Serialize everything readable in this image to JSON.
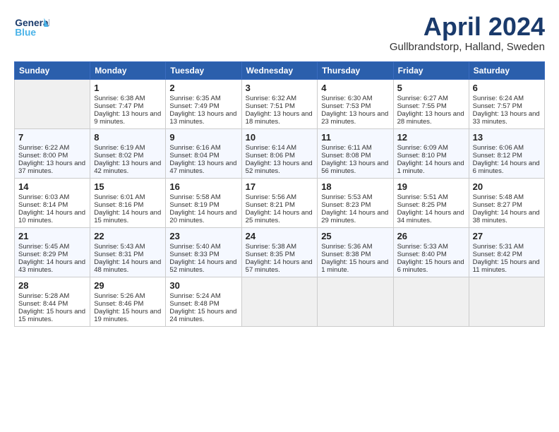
{
  "header": {
    "logo": {
      "line1": "General",
      "line2": "Blue"
    },
    "title": "April 2024",
    "subtitle": "Gullbrandstorp, Halland, Sweden"
  },
  "weekdays": [
    "Sunday",
    "Monday",
    "Tuesday",
    "Wednesday",
    "Thursday",
    "Friday",
    "Saturday"
  ],
  "weeks": [
    [
      {
        "day": "",
        "sunrise": "",
        "sunset": "",
        "daylight": "",
        "empty": true
      },
      {
        "day": "1",
        "sunrise": "Sunrise: 6:38 AM",
        "sunset": "Sunset: 7:47 PM",
        "daylight": "Daylight: 13 hours and 9 minutes."
      },
      {
        "day": "2",
        "sunrise": "Sunrise: 6:35 AM",
        "sunset": "Sunset: 7:49 PM",
        "daylight": "Daylight: 13 hours and 13 minutes."
      },
      {
        "day": "3",
        "sunrise": "Sunrise: 6:32 AM",
        "sunset": "Sunset: 7:51 PM",
        "daylight": "Daylight: 13 hours and 18 minutes."
      },
      {
        "day": "4",
        "sunrise": "Sunrise: 6:30 AM",
        "sunset": "Sunset: 7:53 PM",
        "daylight": "Daylight: 13 hours and 23 minutes."
      },
      {
        "day": "5",
        "sunrise": "Sunrise: 6:27 AM",
        "sunset": "Sunset: 7:55 PM",
        "daylight": "Daylight: 13 hours and 28 minutes."
      },
      {
        "day": "6",
        "sunrise": "Sunrise: 6:24 AM",
        "sunset": "Sunset: 7:57 PM",
        "daylight": "Daylight: 13 hours and 33 minutes."
      }
    ],
    [
      {
        "day": "7",
        "sunrise": "Sunrise: 6:22 AM",
        "sunset": "Sunset: 8:00 PM",
        "daylight": "Daylight: 13 hours and 37 minutes."
      },
      {
        "day": "8",
        "sunrise": "Sunrise: 6:19 AM",
        "sunset": "Sunset: 8:02 PM",
        "daylight": "Daylight: 13 hours and 42 minutes."
      },
      {
        "day": "9",
        "sunrise": "Sunrise: 6:16 AM",
        "sunset": "Sunset: 8:04 PM",
        "daylight": "Daylight: 13 hours and 47 minutes."
      },
      {
        "day": "10",
        "sunrise": "Sunrise: 6:14 AM",
        "sunset": "Sunset: 8:06 PM",
        "daylight": "Daylight: 13 hours and 52 minutes."
      },
      {
        "day": "11",
        "sunrise": "Sunrise: 6:11 AM",
        "sunset": "Sunset: 8:08 PM",
        "daylight": "Daylight: 13 hours and 56 minutes."
      },
      {
        "day": "12",
        "sunrise": "Sunrise: 6:09 AM",
        "sunset": "Sunset: 8:10 PM",
        "daylight": "Daylight: 14 hours and 1 minute."
      },
      {
        "day": "13",
        "sunrise": "Sunrise: 6:06 AM",
        "sunset": "Sunset: 8:12 PM",
        "daylight": "Daylight: 14 hours and 6 minutes."
      }
    ],
    [
      {
        "day": "14",
        "sunrise": "Sunrise: 6:03 AM",
        "sunset": "Sunset: 8:14 PM",
        "daylight": "Daylight: 14 hours and 10 minutes."
      },
      {
        "day": "15",
        "sunrise": "Sunrise: 6:01 AM",
        "sunset": "Sunset: 8:16 PM",
        "daylight": "Daylight: 14 hours and 15 minutes."
      },
      {
        "day": "16",
        "sunrise": "Sunrise: 5:58 AM",
        "sunset": "Sunset: 8:19 PM",
        "daylight": "Daylight: 14 hours and 20 minutes."
      },
      {
        "day": "17",
        "sunrise": "Sunrise: 5:56 AM",
        "sunset": "Sunset: 8:21 PM",
        "daylight": "Daylight: 14 hours and 25 minutes."
      },
      {
        "day": "18",
        "sunrise": "Sunrise: 5:53 AM",
        "sunset": "Sunset: 8:23 PM",
        "daylight": "Daylight: 14 hours and 29 minutes."
      },
      {
        "day": "19",
        "sunrise": "Sunrise: 5:51 AM",
        "sunset": "Sunset: 8:25 PM",
        "daylight": "Daylight: 14 hours and 34 minutes."
      },
      {
        "day": "20",
        "sunrise": "Sunrise: 5:48 AM",
        "sunset": "Sunset: 8:27 PM",
        "daylight": "Daylight: 14 hours and 38 minutes."
      }
    ],
    [
      {
        "day": "21",
        "sunrise": "Sunrise: 5:45 AM",
        "sunset": "Sunset: 8:29 PM",
        "daylight": "Daylight: 14 hours and 43 minutes."
      },
      {
        "day": "22",
        "sunrise": "Sunrise: 5:43 AM",
        "sunset": "Sunset: 8:31 PM",
        "daylight": "Daylight: 14 hours and 48 minutes."
      },
      {
        "day": "23",
        "sunrise": "Sunrise: 5:40 AM",
        "sunset": "Sunset: 8:33 PM",
        "daylight": "Daylight: 14 hours and 52 minutes."
      },
      {
        "day": "24",
        "sunrise": "Sunrise: 5:38 AM",
        "sunset": "Sunset: 8:35 PM",
        "daylight": "Daylight: 14 hours and 57 minutes."
      },
      {
        "day": "25",
        "sunrise": "Sunrise: 5:36 AM",
        "sunset": "Sunset: 8:38 PM",
        "daylight": "Daylight: 15 hours and 1 minute."
      },
      {
        "day": "26",
        "sunrise": "Sunrise: 5:33 AM",
        "sunset": "Sunset: 8:40 PM",
        "daylight": "Daylight: 15 hours and 6 minutes."
      },
      {
        "day": "27",
        "sunrise": "Sunrise: 5:31 AM",
        "sunset": "Sunset: 8:42 PM",
        "daylight": "Daylight: 15 hours and 11 minutes."
      }
    ],
    [
      {
        "day": "28",
        "sunrise": "Sunrise: 5:28 AM",
        "sunset": "Sunset: 8:44 PM",
        "daylight": "Daylight: 15 hours and 15 minutes."
      },
      {
        "day": "29",
        "sunrise": "Sunrise: 5:26 AM",
        "sunset": "Sunset: 8:46 PM",
        "daylight": "Daylight: 15 hours and 19 minutes."
      },
      {
        "day": "30",
        "sunrise": "Sunrise: 5:24 AM",
        "sunset": "Sunset: 8:48 PM",
        "daylight": "Daylight: 15 hours and 24 minutes."
      },
      {
        "day": "",
        "sunrise": "",
        "sunset": "",
        "daylight": "",
        "empty": true
      },
      {
        "day": "",
        "sunrise": "",
        "sunset": "",
        "daylight": "",
        "empty": true
      },
      {
        "day": "",
        "sunrise": "",
        "sunset": "",
        "daylight": "",
        "empty": true
      },
      {
        "day": "",
        "sunrise": "",
        "sunset": "",
        "daylight": "",
        "empty": true
      }
    ]
  ]
}
